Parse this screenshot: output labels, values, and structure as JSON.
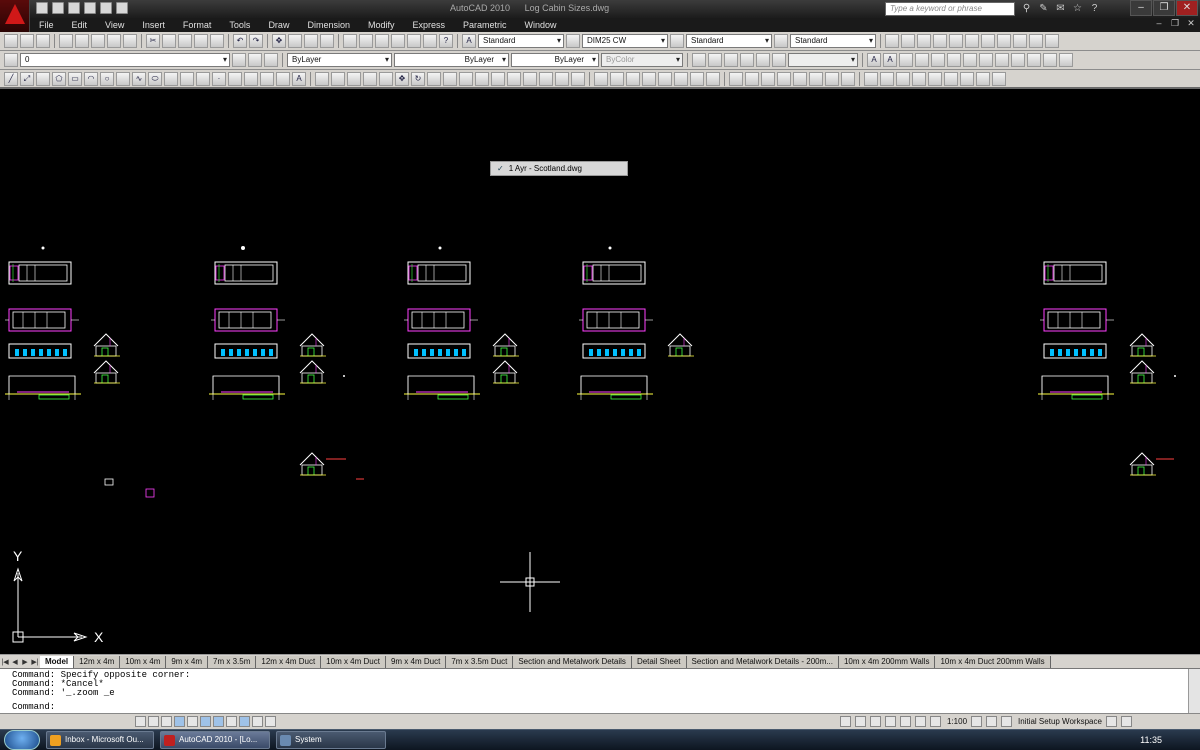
{
  "window": {
    "app_title": "AutoCAD 2010",
    "file_title": "Log Cabin Sizes.dwg",
    "search_placeholder": "Type a keyword or phrase"
  },
  "menu": [
    "File",
    "Edit",
    "View",
    "Insert",
    "Format",
    "Tools",
    "Draw",
    "Dimension",
    "Modify",
    "Express",
    "Parametric",
    "Window"
  ],
  "toolbar1": {
    "text_style": "Standard",
    "dim_style": "DIM25 CW",
    "table_style": "Standard",
    "mleader_style": "Standard"
  },
  "toolbar2": {
    "layer": "0",
    "color": "ByLayer",
    "linetype": "ByLayer",
    "lineweight": "ByLayer",
    "plotstyle": "ByColor"
  },
  "drawing": {
    "popup_item": "1 Ayr - Scotland.dwg",
    "ucs_x": "X",
    "ucs_y": "Y"
  },
  "layout_tabs": [
    "Model",
    "12m x 4m",
    "10m x 4m",
    "9m x 4m",
    "7m x 3.5m",
    "12m x 4m Duct",
    "10m x 4m Duct",
    "9m x 4m Duct",
    "7m x 3.5m Duct",
    "Section and Metalwork Details",
    "Detail Sheet",
    "Section and Metalwork Details - 200m...",
    "10m x 4m 200mm Walls",
    "10m x 4m Duct 200mm Walls"
  ],
  "command_history": [
    "Command: Specify opposite corner:",
    "Command: *Cancel*",
    "Command: '_.zoom _e"
  ],
  "command_prompt": "Command:",
  "status": {
    "annotation_scale": "1:100",
    "workspace": "Initial Setup Workspace"
  },
  "taskbar": {
    "items": [
      "Inbox - Microsoft Ou...",
      "AutoCAD 2010 - [Lo...",
      "System"
    ],
    "clock": "11:35"
  }
}
